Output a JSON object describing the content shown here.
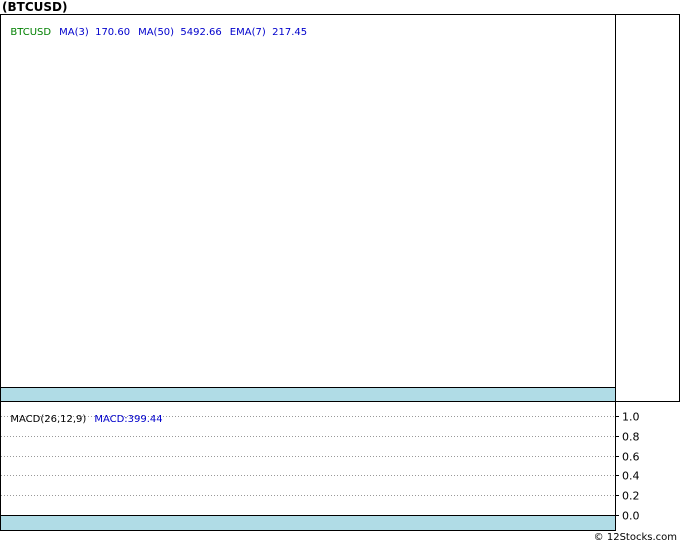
{
  "header": {
    "title": "(BTCUSD)"
  },
  "price_legend": {
    "symbol": "BTCUSD",
    "ma3": "MA(3)  170.60",
    "ma50": "MA(50)  5492.66",
    "ema7": "EMA(7)  217.45",
    "colors": {
      "symbol": "#008000",
      "indicators": "#0000cc"
    }
  },
  "macd_legend": {
    "name": "MACD(26,12,9)",
    "value": "MACD:399.44",
    "colors": {
      "name": "#000000",
      "value": "#0000cc"
    }
  },
  "footer": {
    "copyright": "© 12Stocks.com"
  },
  "chart_data": [
    {
      "type": "line",
      "title": "(BTCUSD)",
      "series": [],
      "indicators": [
        {
          "name": "MA(3)",
          "value": 170.6
        },
        {
          "name": "MA(50)",
          "value": 5492.66
        },
        {
          "name": "EMA(7)",
          "value": 217.45
        }
      ]
    },
    {
      "type": "line",
      "title": "MACD(26,12,9)",
      "ylim": [
        0.0,
        1.0
      ],
      "yticks": [
        "1.0",
        "0.8",
        "0.6",
        "0.4",
        "0.2",
        "0.0"
      ],
      "grid": true,
      "series": [
        {
          "name": "MACD",
          "current": 399.44,
          "values": []
        }
      ]
    }
  ]
}
